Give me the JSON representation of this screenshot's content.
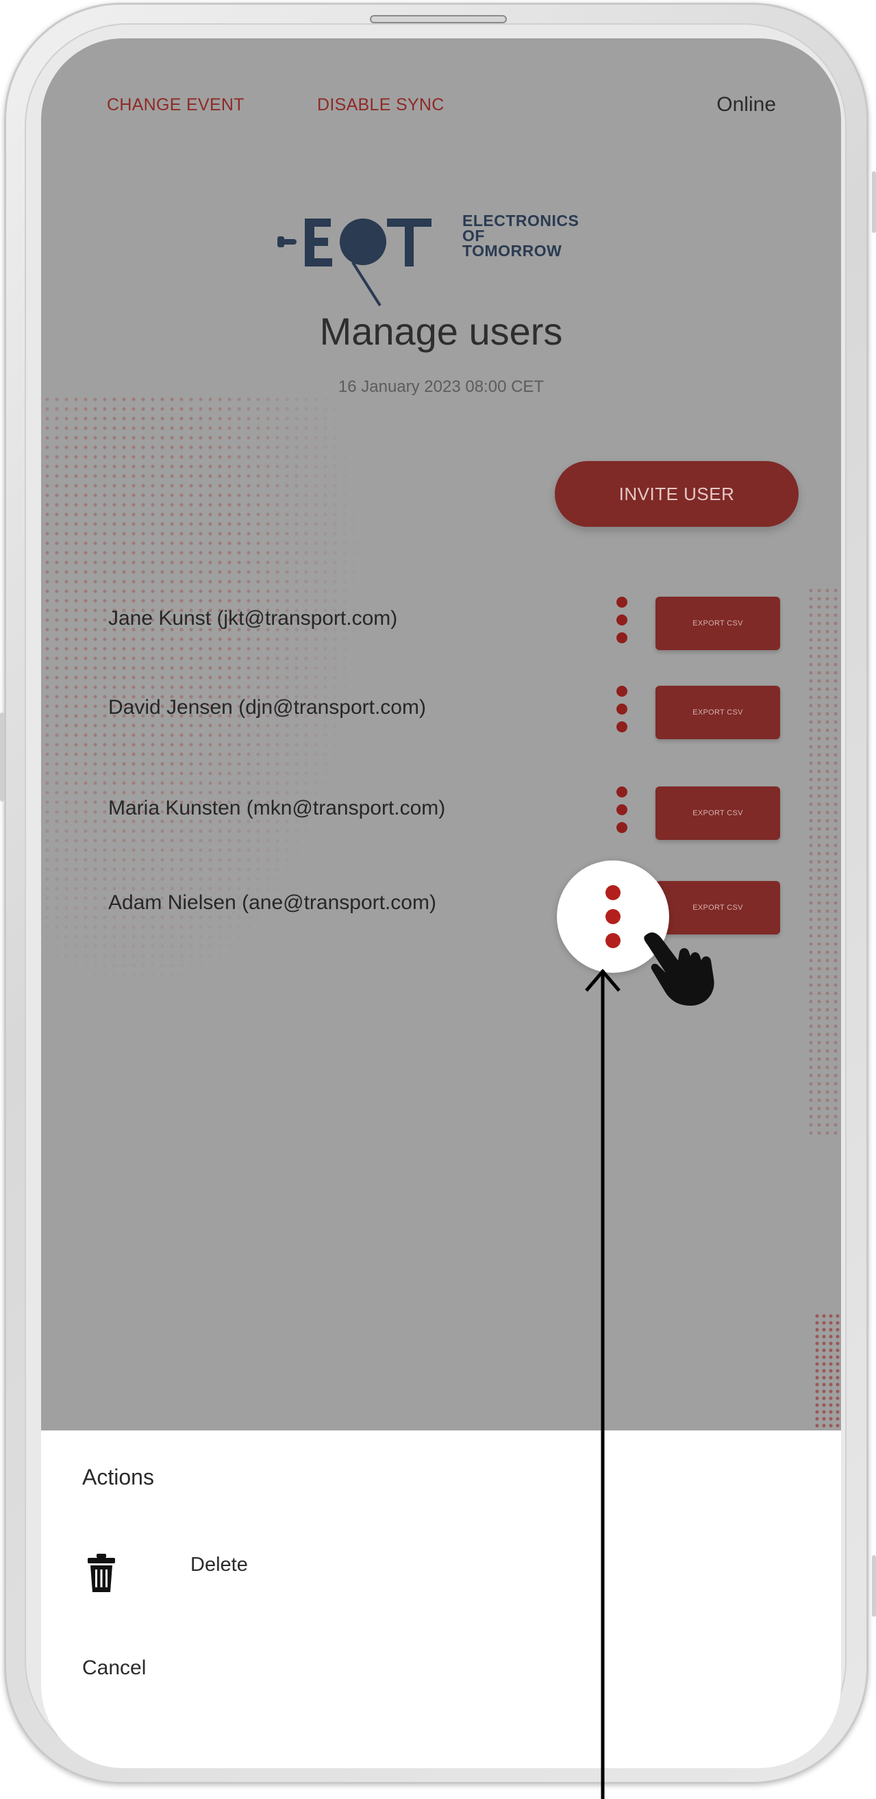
{
  "header": {
    "change_event_label": "CHANGE EVENT",
    "disable_sync_label": "DISABLE SYNC",
    "status_text": "Online"
  },
  "logo": {
    "letters": "EOT",
    "line1": "ELECTRONICS",
    "line2": "OF TOMORROW"
  },
  "page": {
    "title": "Manage users",
    "datetime": "16 January 2023  08:00 CET"
  },
  "invite_button_label": "INVITE USER",
  "users": [
    {
      "label": "Jane Kunst (jkt@transport.com)",
      "export_label": "EXPORT CSV"
    },
    {
      "label": "David Jensen (djn@transport.com)",
      "export_label": "EXPORT CSV"
    },
    {
      "label": "Maria Kunsten (mkn@transport.com)",
      "export_label": "EXPORT CSV"
    },
    {
      "label": "Adam Nielsen (ane@transport.com)",
      "export_label": "EXPORT CSV"
    }
  ],
  "action_sheet": {
    "title": "Actions",
    "delete_label": "Delete",
    "delete_icon": "trash-icon",
    "cancel_label": "Cancel"
  },
  "colors": {
    "accent": "#7f2a27",
    "overlay": "#a0a0a0",
    "logo_navy": "#2a3b52"
  }
}
